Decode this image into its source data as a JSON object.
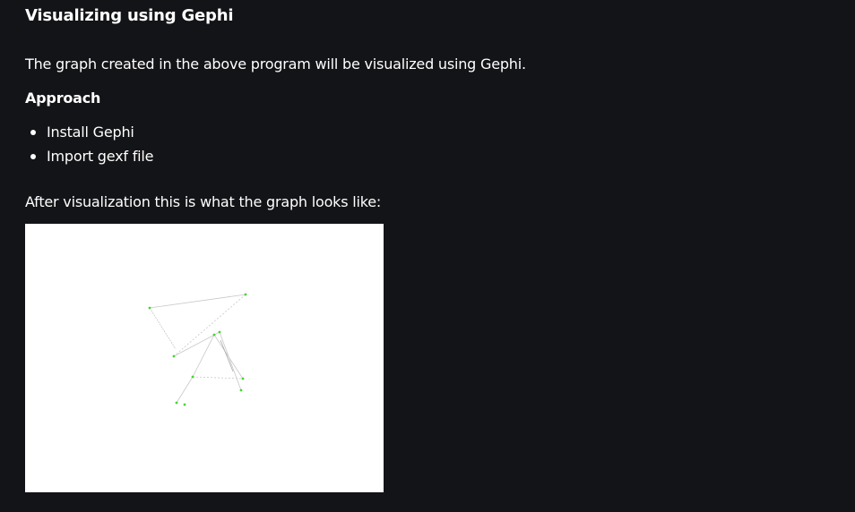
{
  "article": {
    "heading": "Visualizing using Gephi",
    "intro": "The graph created in the above program will be visualized using Gephi.",
    "approach_label": "Approach",
    "steps": [
      "Install Gephi",
      "Import gexf file"
    ],
    "after_text": "After visualization this is what the graph looks like:"
  },
  "colors": {
    "background": "#131417",
    "text": "#ffffff",
    "image_background": "#ffffff",
    "node": "#4cd137",
    "edge": "#c8c8c8"
  }
}
